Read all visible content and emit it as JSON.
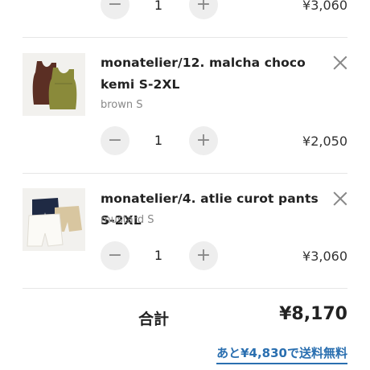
{
  "cart": {
    "items": [
      {
        "title": "",
        "variant": "",
        "quantity": "1",
        "price": "¥3,060",
        "minus_label": "−",
        "plus_label": "+"
      },
      {
        "title": "monatelier/12. malcha choco kemi S-2XL",
        "variant": "brown S",
        "quantity": "1",
        "price": "¥2,050",
        "minus_label": "−",
        "plus_label": "+"
      },
      {
        "title": "monatelier/4. atlie curot pants S-2XL",
        "variant": "mustard S",
        "quantity": "1",
        "price": "¥3,060",
        "minus_label": "−",
        "plus_label": "+"
      }
    ],
    "total_label": "合計",
    "total_value": "¥8,170",
    "free_shipping_text": "あと¥4,830で送料無料"
  },
  "colors": {
    "accent": "#2a6fb0",
    "button_bg": "#eeeeee",
    "muted_text": "#888888"
  }
}
